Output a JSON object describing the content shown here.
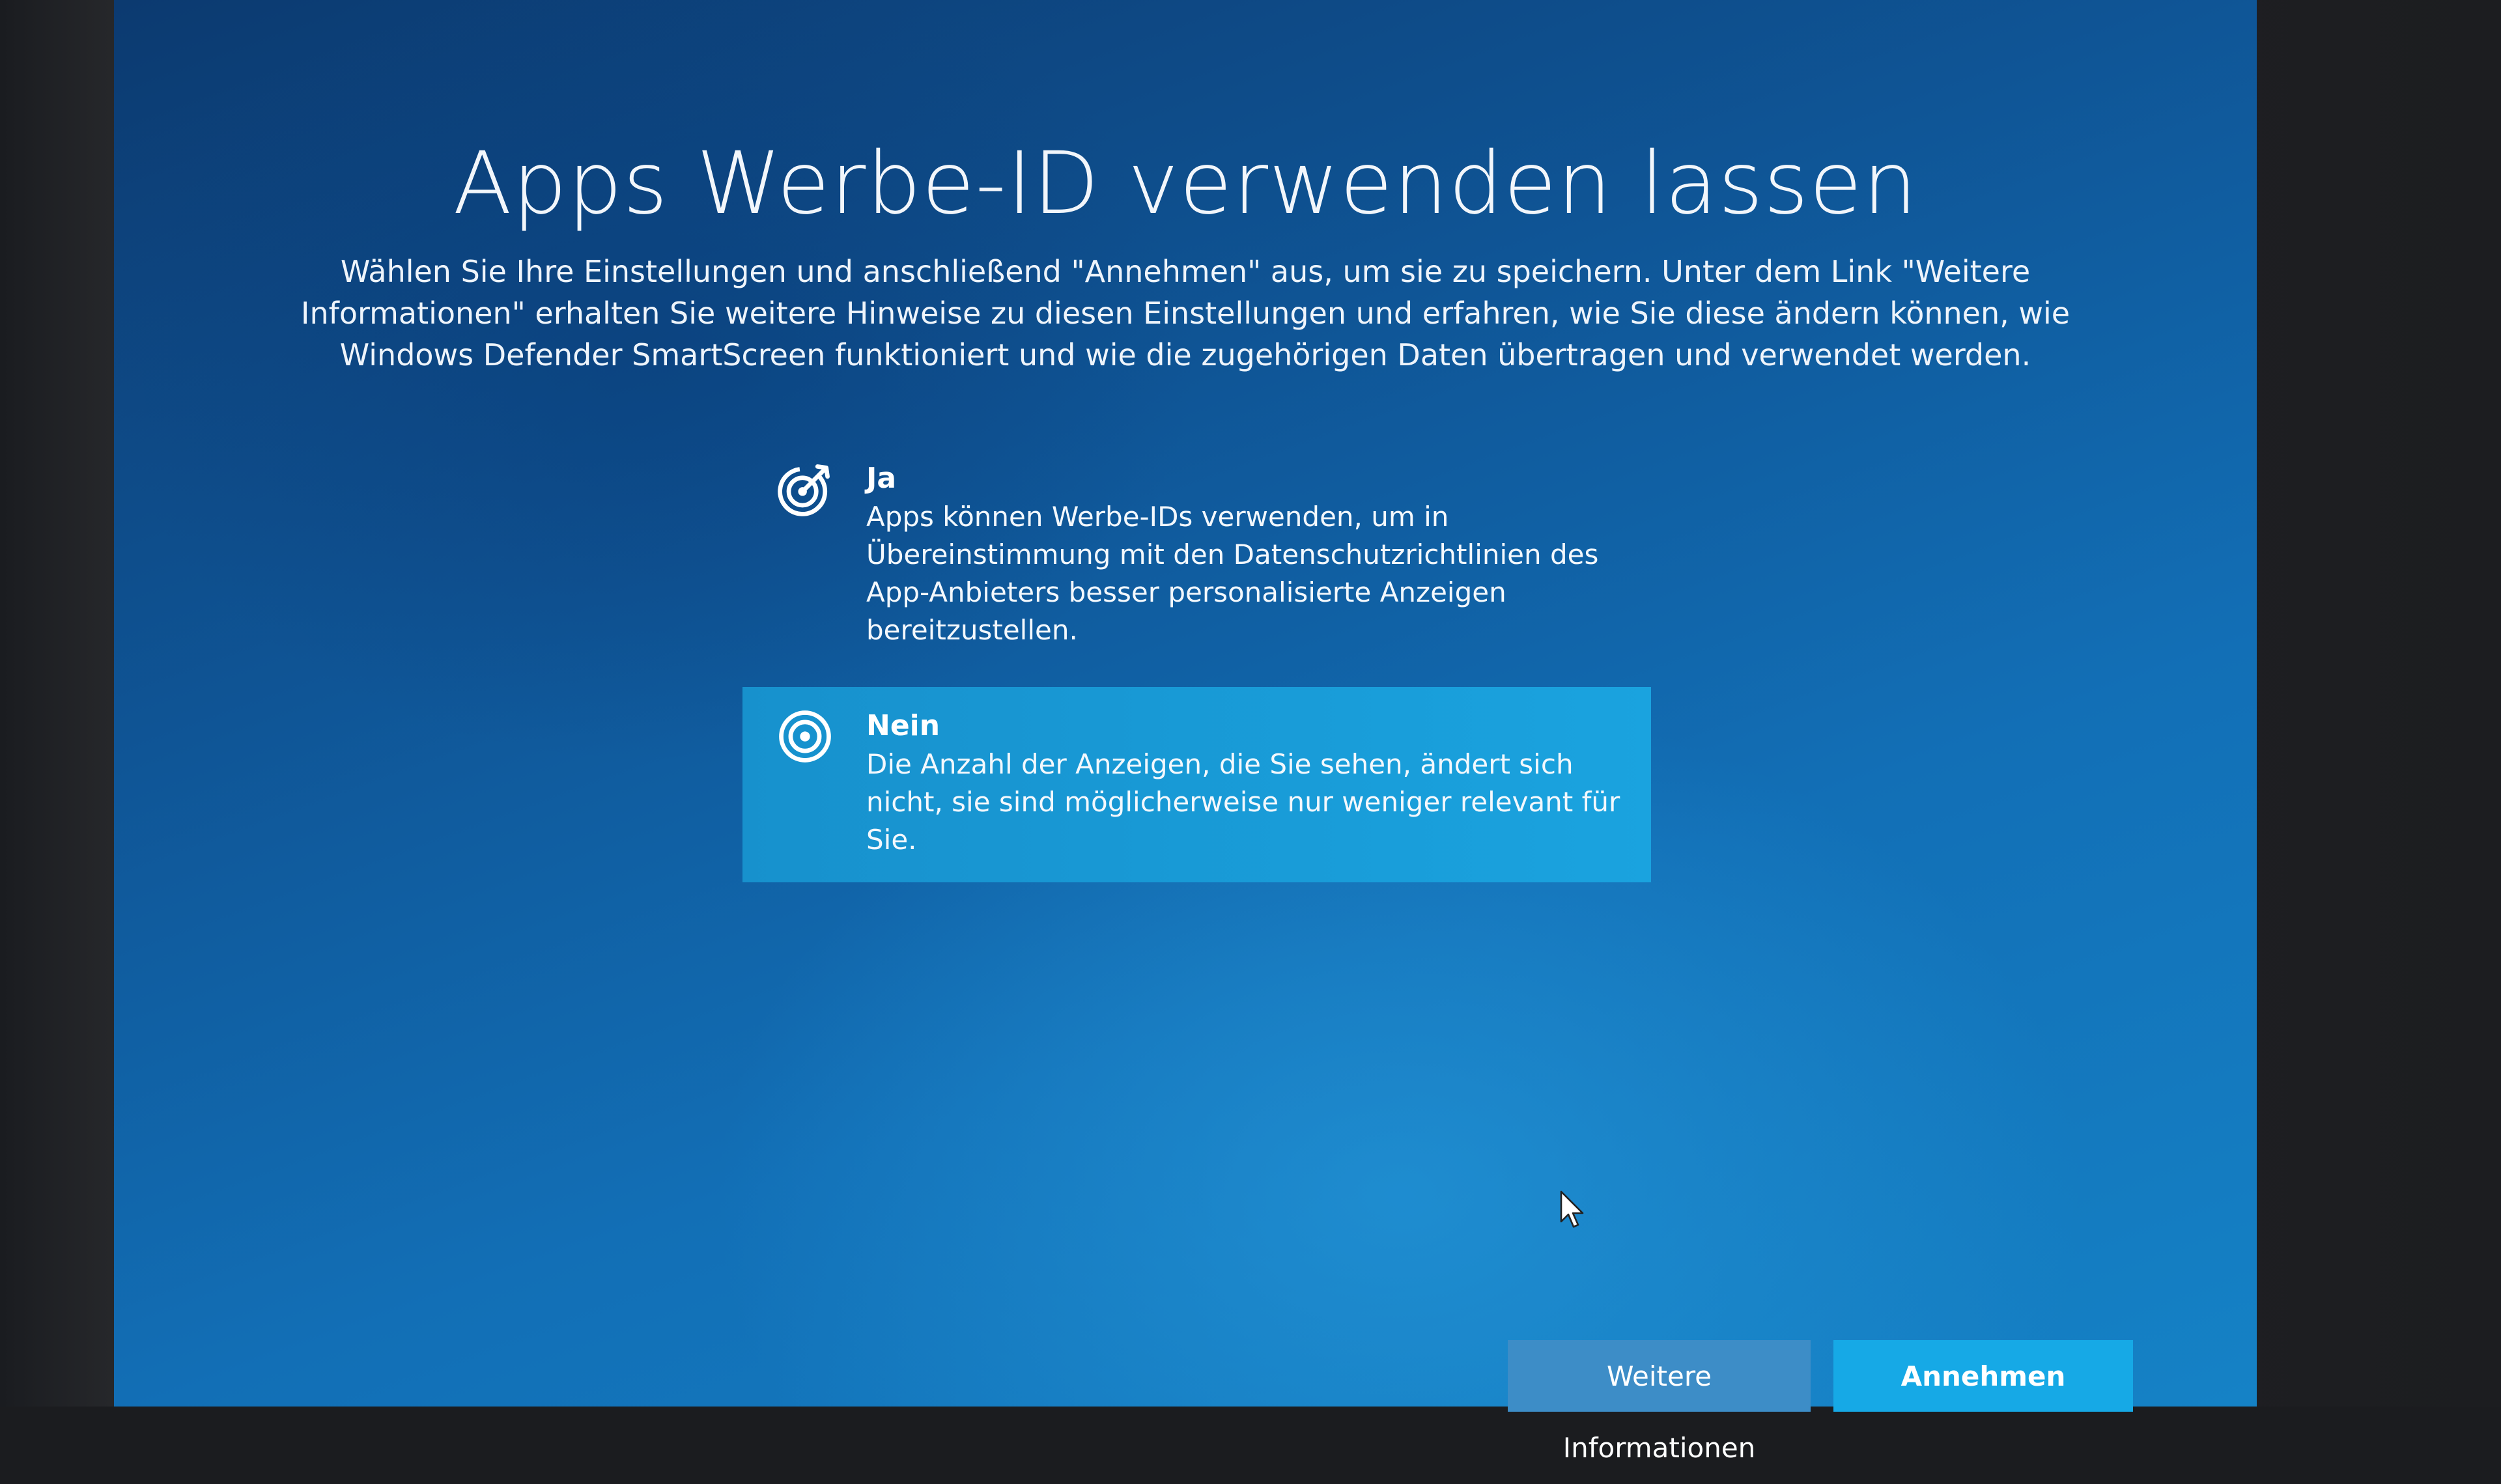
{
  "page": {
    "title": "Apps Werbe-ID verwenden lassen",
    "description": "Wählen Sie Ihre Einstellungen und anschließend \"Annehmen\" aus, um sie zu speichern. Unter dem Link \"Weitere Informationen\" erhalten Sie weitere Hinweise zu diesen Einstellungen und erfahren, wie Sie diese ändern können, wie Windows Defender SmartScreen funktioniert und wie die zugehörigen Daten übertragen und verwendet werden."
  },
  "options": [
    {
      "label": "Ja",
      "text": "Apps können Werbe-IDs verwenden, um in Übereinstimmung mit den Datenschutzrichtlinien des App-Anbieters besser personalisierte Anzeigen bereitzustellen.",
      "icon": "target-arrow-icon",
      "selected": false
    },
    {
      "label": "Nein",
      "text": "Die Anzahl der Anzeigen, die Sie sehen, ändert sich nicht, sie sind möglicherweise nur weniger relevant für Sie.",
      "icon": "target-icon",
      "selected": true
    }
  ],
  "buttons": {
    "more_info": "Weitere Informationen",
    "accept": "Annehmen"
  },
  "colors": {
    "background": "#0f5596",
    "selected_option": "#1a9fdc",
    "accept_button": "#16a9e6",
    "more_info_button": "#3d8dc7"
  }
}
